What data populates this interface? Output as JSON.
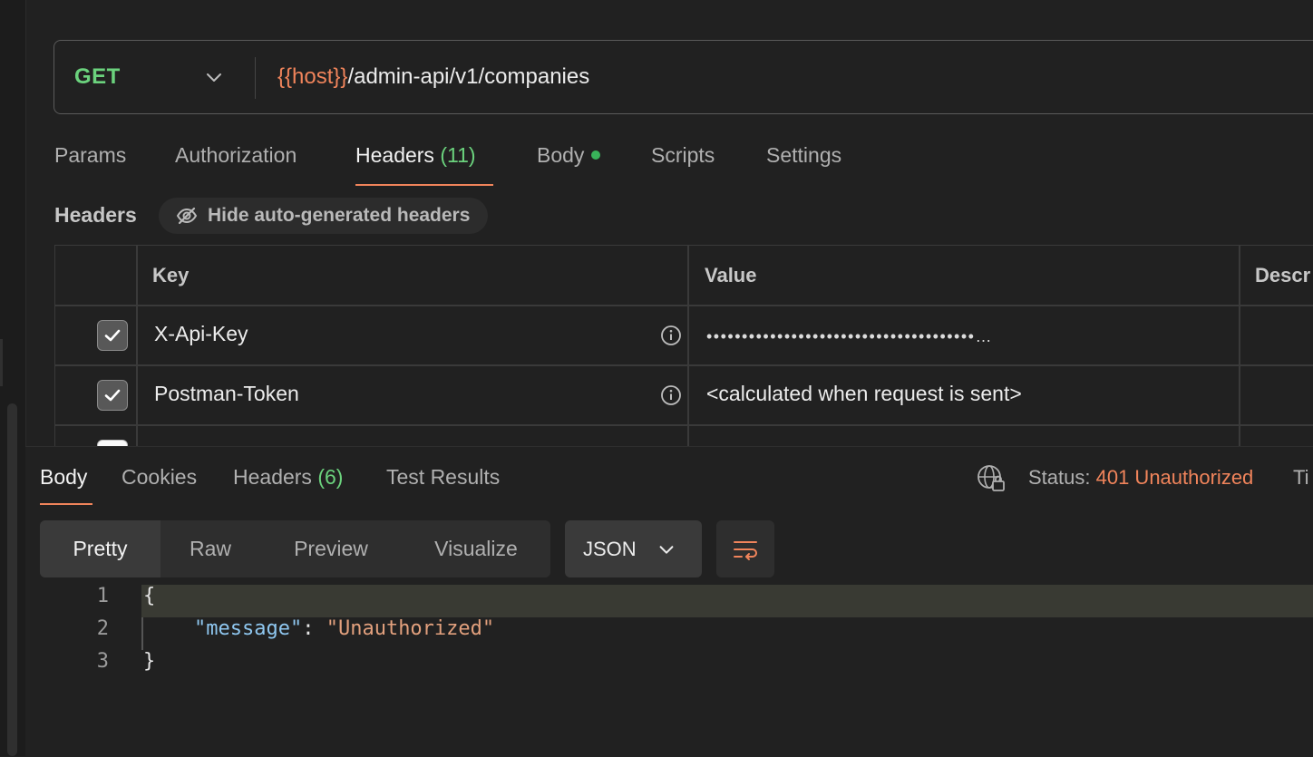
{
  "request": {
    "method": "GET",
    "url_variable": "{{host}}",
    "url_path": "/admin-api/v1/companies"
  },
  "request_tabs": [
    {
      "label": "Params"
    },
    {
      "label": "Authorization"
    },
    {
      "label": "Headers",
      "count": "(11)"
    },
    {
      "label": "Body"
    },
    {
      "label": "Scripts"
    },
    {
      "label": "Settings"
    }
  ],
  "headers_section": {
    "title": "Headers",
    "hide_toggle_label": "Hide auto-generated headers",
    "columns": [
      "Key",
      "Value",
      "Descr"
    ],
    "rows": [
      {
        "key": "X-Api-Key",
        "value": "••••••••••••••••••••••••••••••••••••••…",
        "checked": true
      },
      {
        "key": "Postman-Token",
        "value": "<calculated when request is sent>",
        "checked": true
      }
    ]
  },
  "response": {
    "tabs": [
      {
        "label": "Body"
      },
      {
        "label": "Cookies"
      },
      {
        "label": "Headers",
        "count": "(6)"
      },
      {
        "label": "Test Results"
      }
    ],
    "status_label": "Status:",
    "status_value": "401 Unauthorized",
    "time_label_partial": "Ti",
    "format_buttons": [
      "Pretty",
      "Raw",
      "Preview",
      "Visualize"
    ],
    "language": "JSON",
    "code_lines": [
      {
        "n": "1",
        "text": "{"
      },
      {
        "n": "2",
        "key": "\"message\"",
        "sep": ": ",
        "value": "\"Unauthorized\""
      },
      {
        "n": "3",
        "text": "}"
      }
    ]
  },
  "colors": {
    "method_get": "#6bd27d",
    "accent": "#f0845b",
    "status_error": "#f0845b",
    "count_green": "#6bd27d"
  }
}
